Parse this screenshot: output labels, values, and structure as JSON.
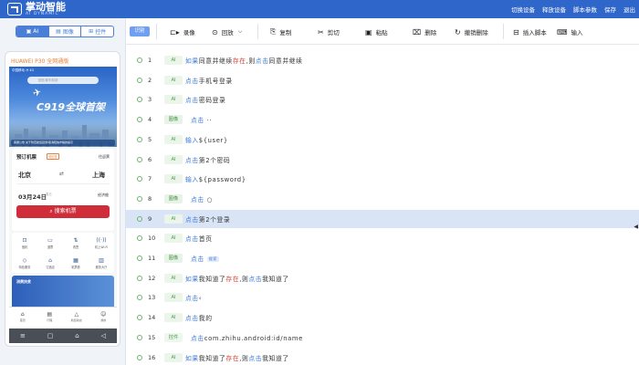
{
  "app": {
    "logo_text": "掌动智能",
    "logo_sub": "AI DYNAMIC",
    "top_nav": [
      "切换设备",
      "释放设备",
      "脚本参数",
      "保存",
      "退出"
    ]
  },
  "left_panel": {
    "mode_tabs": [
      {
        "label": "AI",
        "icon": "ai-icon",
        "active": true
      },
      {
        "label": "图像",
        "icon": "image-icon",
        "active": false
      },
      {
        "label": "控件",
        "icon": "widget-icon",
        "active": false
      }
    ],
    "device_name": "HUAWEI P30 全网通版",
    "phone": {
      "status_text": "中国移动 ◔ 4G",
      "search_placeholder": "航班/城市/机场",
      "hero_title": "C919全球首架",
      "notice": "客服公告   关于防范航班延误/取消短信诈骗的提示",
      "booking_title": "预订机票",
      "booking_badge": "领优惠",
      "booking_right": "往返票",
      "from_city": "北京",
      "to_city": "上海",
      "date": "03月24日",
      "date_sub": "周五",
      "cabin": "经济舱",
      "search_button": "搜索机票",
      "grid": [
        {
          "label": "值机",
          "icon": "checkin-icon"
        },
        {
          "label": "退票",
          "icon": "refund-icon"
        },
        {
          "label": "改签",
          "icon": "change-icon"
        },
        {
          "label": "机上Wi-Fi",
          "icon": "wifi-icon"
        },
        {
          "label": "特色服务",
          "icon": "service-icon"
        },
        {
          "label": "订酒店",
          "icon": "hotel-icon"
        },
        {
          "label": "机票券",
          "icon": "coupon-icon"
        },
        {
          "label": "服务大厅",
          "icon": "hall-icon"
        }
      ],
      "promo_text": "消费扶贫",
      "bottom_nav": [
        {
          "label": "首页",
          "icon": "home-icon"
        },
        {
          "label": "行程",
          "icon": "trip-icon"
        },
        {
          "label": "航班动态",
          "icon": "flight-icon"
        },
        {
          "label": "我的",
          "icon": "profile-icon"
        }
      ]
    }
  },
  "toolbar": {
    "record_toggle": "识别",
    "buttons": [
      {
        "label": "录像",
        "icon": "video-icon"
      },
      {
        "label": "回放",
        "icon": "replay-icon"
      },
      {
        "label": "复制",
        "icon": "copy-icon"
      },
      {
        "label": "剪切",
        "icon": "cut-icon"
      },
      {
        "label": "粘贴",
        "icon": "paste-icon"
      },
      {
        "label": "删除",
        "icon": "delete-icon"
      },
      {
        "label": "撤销删除",
        "icon": "undo-icon"
      },
      {
        "label": "插入脚本",
        "icon": "insert-script-icon"
      },
      {
        "label": "输入",
        "icon": "input-icon"
      }
    ]
  },
  "script_rows": [
    {
      "num": "1",
      "type": "AI",
      "segments": [
        [
          "kw",
          "如果"
        ],
        [
          "t",
          "同意并继续"
        ],
        [
          "red",
          "存在"
        ],
        [
          "t",
          ",则"
        ],
        [
          "kw",
          "点击"
        ],
        [
          "t",
          "同意并继续"
        ]
      ]
    },
    {
      "num": "2",
      "type": "AI",
      "segments": [
        [
          "kw",
          "点击"
        ],
        [
          "t",
          "手机号登录"
        ]
      ]
    },
    {
      "num": "3",
      "type": "AI",
      "segments": [
        [
          "kw",
          "点击"
        ],
        [
          "t",
          "密码登录"
        ]
      ]
    },
    {
      "num": "4",
      "type": "图像",
      "segments": [
        [
          "pad",
          ""
        ],
        [
          "kw",
          "点击"
        ],
        [
          "t",
          " ··"
        ]
      ]
    },
    {
      "num": "5",
      "type": "AI",
      "segments": [
        [
          "kw",
          "输入"
        ],
        [
          "t",
          "${user}"
        ]
      ]
    },
    {
      "num": "6",
      "type": "AI",
      "segments": [
        [
          "kw",
          "点击"
        ],
        [
          "t",
          "第2个密码"
        ]
      ]
    },
    {
      "num": "7",
      "type": "AI",
      "segments": [
        [
          "kw",
          "输入"
        ],
        [
          "t",
          "${password}"
        ]
      ]
    },
    {
      "num": "8",
      "type": "图像",
      "segments": [
        [
          "pad",
          ""
        ],
        [
          "kw",
          "点击"
        ],
        [
          "t",
          " ○"
        ]
      ]
    },
    {
      "num": "9",
      "type": "AI",
      "segments": [
        [
          "kw",
          "点击"
        ],
        [
          "t",
          "第2个登录"
        ]
      ],
      "selected": true
    },
    {
      "num": "10",
      "type": "AI",
      "segments": [
        [
          "kw",
          "点击"
        ],
        [
          "t",
          "首页"
        ]
      ]
    },
    {
      "num": "11",
      "type": "图像",
      "segments": [
        [
          "pad",
          ""
        ],
        [
          "kw",
          "点击"
        ],
        [
          "btn",
          "搜索"
        ]
      ]
    },
    {
      "num": "12",
      "type": "AI",
      "segments": [
        [
          "kw",
          "如果"
        ],
        [
          "t",
          "我知道了"
        ],
        [
          "red",
          "存在"
        ],
        [
          "t",
          ",则"
        ],
        [
          "kw",
          "点击"
        ],
        [
          "t",
          "我知道了"
        ]
      ]
    },
    {
      "num": "13",
      "type": "AI",
      "segments": [
        [
          "kw",
          "点击"
        ],
        [
          "t",
          "‹"
        ]
      ]
    },
    {
      "num": "14",
      "type": "AI",
      "segments": [
        [
          "kw",
          "点击"
        ],
        [
          "t",
          "我的"
        ]
      ]
    },
    {
      "num": "15",
      "type": "控件",
      "segments": [
        [
          "pad",
          ""
        ],
        [
          "kw",
          "点击"
        ],
        [
          "t",
          "com.zhihu.android:id/name"
        ]
      ]
    },
    {
      "num": "16",
      "type": "AI",
      "segments": [
        [
          "kw",
          "如果"
        ],
        [
          "t",
          "我知道了"
        ],
        [
          "red",
          "存在"
        ],
        [
          "t",
          ",则"
        ],
        [
          "kw",
          "点击"
        ],
        [
          "t",
          "我知道了"
        ]
      ]
    }
  ],
  "colors": {
    "topbar": "#2f66c9",
    "accent": "#4a7fd8",
    "keyword_blue": "#3b7bd8",
    "keyword_red": "#d0473d",
    "search_red": "#cf2d3a",
    "selected_row": "#d9e5f7",
    "device_name": "#e8803a"
  }
}
